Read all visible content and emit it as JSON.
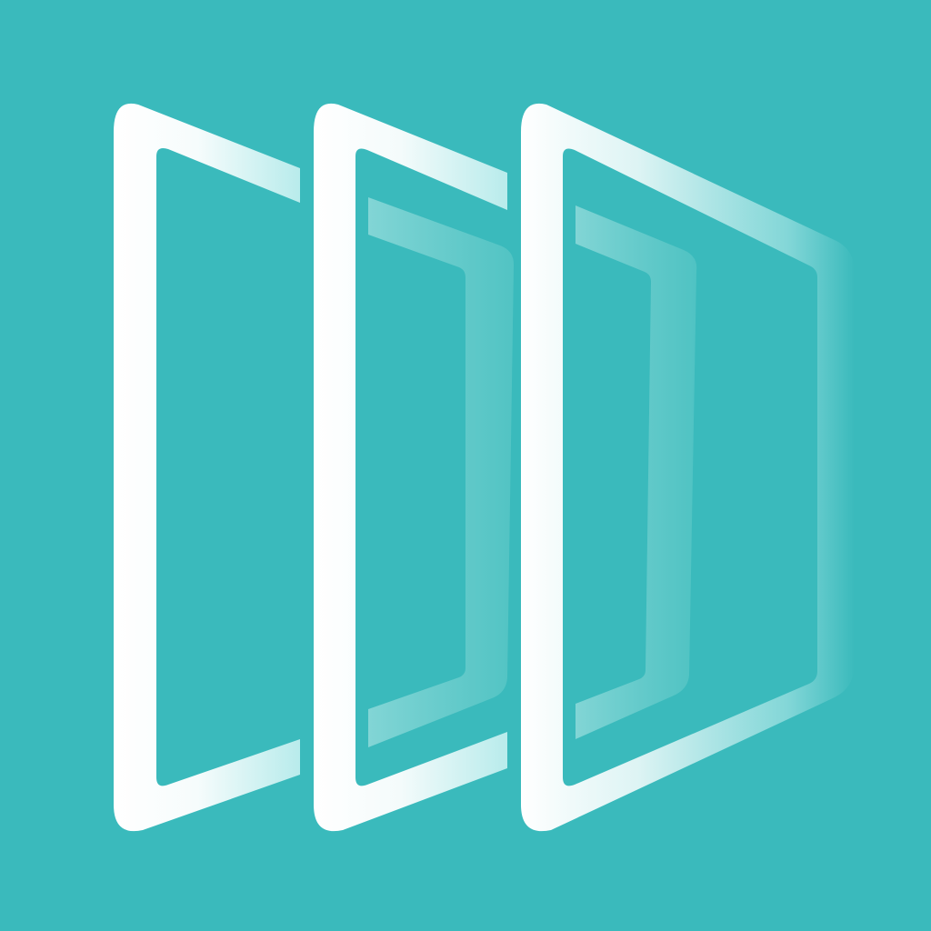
{
  "icon": {
    "name": "stacked-door-frames-logo",
    "colors": {
      "background": "#3ababc",
      "frame": "#ffffff",
      "frame_fade": "#bfeeee",
      "inner_panel": "#7fd3d2"
    },
    "frame_count": 3
  }
}
